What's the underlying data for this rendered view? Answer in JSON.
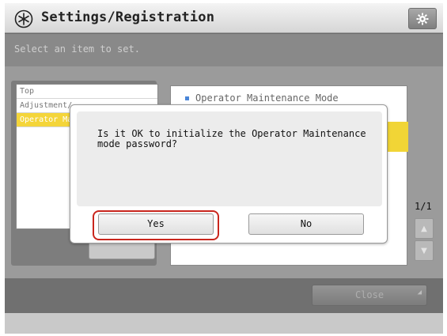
{
  "header": {
    "title": "Settings/Registration",
    "settings_icon": "gear-icon",
    "app_icon": "settings-asterisk-icon"
  },
  "instruction": "Select an item to set.",
  "left_list": {
    "items": [
      {
        "label": "Top",
        "selected": false
      },
      {
        "label": "Adjustment/",
        "selected": false
      },
      {
        "label": "Operator Ma",
        "selected": true
      }
    ]
  },
  "right_panel": {
    "header": "Operator Maintenance Mode"
  },
  "pagination": {
    "page": "1/1"
  },
  "footer": {
    "close_label": "Close"
  },
  "dialog": {
    "message": "Is it OK to initialize the Operator Maintenance mode password?",
    "yes_label": "Yes",
    "no_label": "No"
  },
  "colors": {
    "accent_selected": "#f4d53a",
    "highlight_ring": "#c9261d",
    "bullet": "#4a86d8"
  }
}
